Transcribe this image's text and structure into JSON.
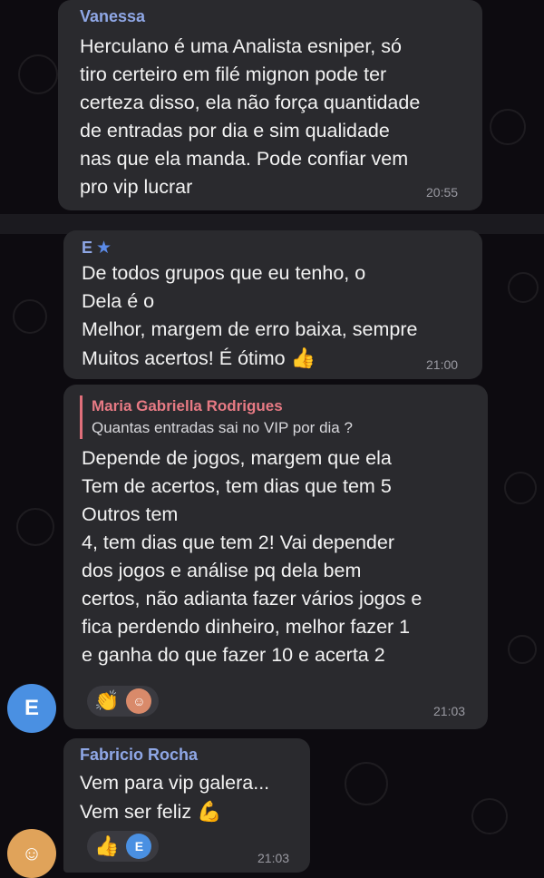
{
  "messages": [
    {
      "sender": "Vanessa",
      "text": "Herculano é uma Analista esniper, só\ntiro certeiro em filé mignon pode ter\ncerteza disso, ela não força quantidade\nde entradas por dia e sim qualidade\nnas que ela manda. Pode confiar vem\npro vip lucrar",
      "time": "20:55"
    },
    {
      "sender": "E",
      "sender_badge": "star-icon",
      "text": "De todos grupos que eu tenho, o\nDela é o\nMelhor, margem de erro baixa, sempre\nMuitos acertos! É ótimo",
      "emoji": "thumbs-up-icon",
      "time": "21:00"
    },
    {
      "reply_to": {
        "name": "Maria Gabriella Rodrigues",
        "text": "Quantas entradas sai no VIP por dia ?"
      },
      "text": "Depende de jogos, margem que ela\nTem de acertos, tem dias que tem 5\nOutros tem\n4, tem dias que tem 2! Vai depender\ndos jogos e análise pq dela bem\ncertos, não adianta fazer vários jogos e\nfica perdendo dinheiro, melhor fazer 1\ne ganha do que fazer 10 e acerta 2",
      "reactions": [
        "clapping-hands-icon",
        "reactor-avatar"
      ],
      "time": "21:03",
      "author_avatar_letter": "E"
    },
    {
      "sender": "Fabricio Rocha",
      "text": "Vem para vip galera...\nVem ser feliz",
      "emoji": "flexed-biceps-icon",
      "reactions": [
        "thumbs-up-icon",
        "reactor-avatar-E"
      ],
      "reactor_letter": "E",
      "time": "21:03"
    }
  ],
  "colors": {
    "bubble": "#2a2a2e",
    "sender_name": "#8fa7e6",
    "reply_name": "#e77a84",
    "avatar_blue": "#4a90e2"
  }
}
